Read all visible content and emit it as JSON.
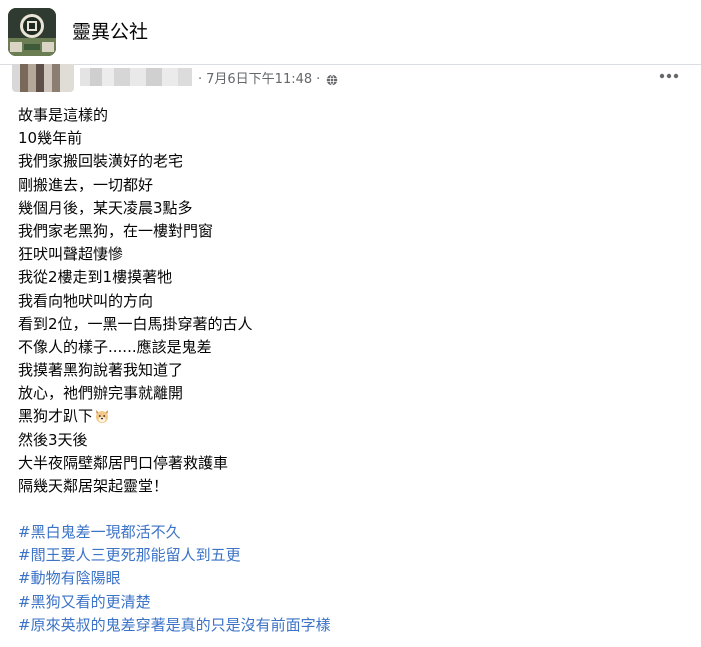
{
  "group": {
    "name": "靈異公社",
    "avatar_icon": "group-avatar-logo"
  },
  "post": {
    "author_name_blurred": "",
    "timestamp": "7月6日下午11:48",
    "separator": "·",
    "privacy_icon": "globe-icon",
    "more_icon": "more-options-icon",
    "lines": [
      "故事是這樣的",
      "10幾年前",
      "我們家搬回裝潢好的老宅",
      "剛搬進去，一切都好",
      "幾個月後，某天凌晨3點多",
      "我們家老黑狗，在一樓對門窗",
      "狂吠叫聲超悽慘",
      "我從2樓走到1樓摸著牠",
      "我看向牠吠叫的方向",
      "看到2位，一黑一白馬掛穿著的古人",
      "不像人的樣子......應該是鬼差",
      "我摸著黑狗說著我知道了",
      "放心，祂們辦完事就離開",
      "黑狗才趴下",
      "然後3天後",
      "大半夜隔壁鄰居門口停著救護車",
      "隔幾天鄰居架起靈堂！"
    ],
    "dog_emoji_icon": "dog-face-emoji-icon",
    "hashtags": [
      "#黑白鬼差一現都活不久",
      "#閻王要人三更死那能留人到五更",
      "#動物有陰陽眼",
      "#黑狗又看的更清楚",
      "#原來英叔的鬼差穿著是真的只是沒有前面字樣"
    ]
  },
  "colors": {
    "text": "#050505",
    "meta": "#65676b",
    "hashtag": "#3b73c7",
    "divider": "#dadde1"
  }
}
